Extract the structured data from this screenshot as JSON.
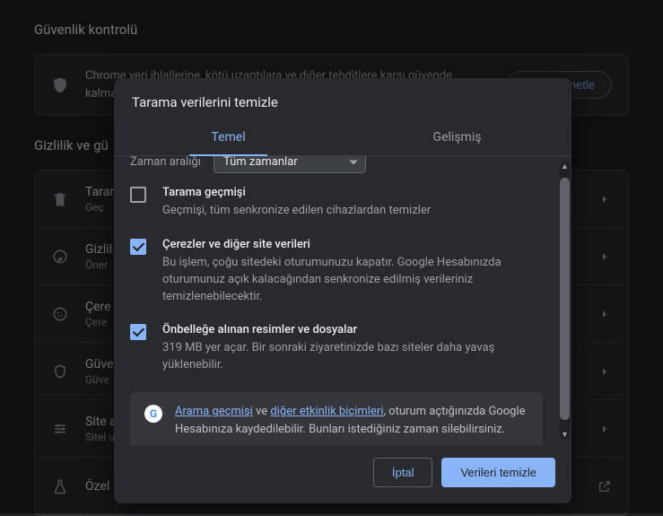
{
  "page": {
    "security_check_title": "Güvenlik kontrolü",
    "security_check_text": "Chrome veri ihlallerine, kötü uzantılara ve diğer tehditlere karşı güvende kalmanıza yardı",
    "check_now_button": "Şimdi denetle",
    "privacy_title": "Gizlilik ve gü",
    "rows": [
      {
        "title": "Tarama",
        "sub": "Geç"
      },
      {
        "title": "Gizlil",
        "sub": "Öner"
      },
      {
        "title": "Çere",
        "sub": "Çere"
      },
      {
        "title": "Güve",
        "sub": "Güve"
      },
      {
        "title": "Site a",
        "sub": "Sitel up'la"
      },
      {
        "title": "Özel",
        "sub": ""
      }
    ]
  },
  "dialog": {
    "title": "Tarama verilerini temizle",
    "tabs": {
      "basic": "Temel",
      "advanced": "Gelişmiş"
    },
    "time_label": "Zaman aralığı",
    "time_value": "Tüm zamanlar",
    "items": [
      {
        "checked": false,
        "title": "Tarama geçmişi",
        "desc": "Geçmişi, tüm senkronize edilen cihazlardan temizler"
      },
      {
        "checked": true,
        "title": "Çerezler ve diğer site verileri",
        "desc": "Bu işlem, çoğu sitedeki oturumunuzu kapatır. Google Hesabınızda oturumunuz açık kalacağından senkronize edilmiş verileriniz temizlenebilecektir."
      },
      {
        "checked": true,
        "title": "Önbelleğe alınan resimler ve dosyalar",
        "desc": "319 MB yer açar. Bir sonraki ziyaretinizde bazı siteler daha yavaş yüklenebilir."
      }
    ],
    "info": {
      "link1": "Arama geçmişi",
      "mid1": " ve ",
      "link2": "diğer etkinlik biçimleri",
      "rest": ", oturum açtığınızda Google Hesabınıza kaydedilebilir. Bunları istediğiniz zaman silebilirsiniz."
    },
    "cancel": "İptal",
    "confirm": "Verileri temizle"
  }
}
